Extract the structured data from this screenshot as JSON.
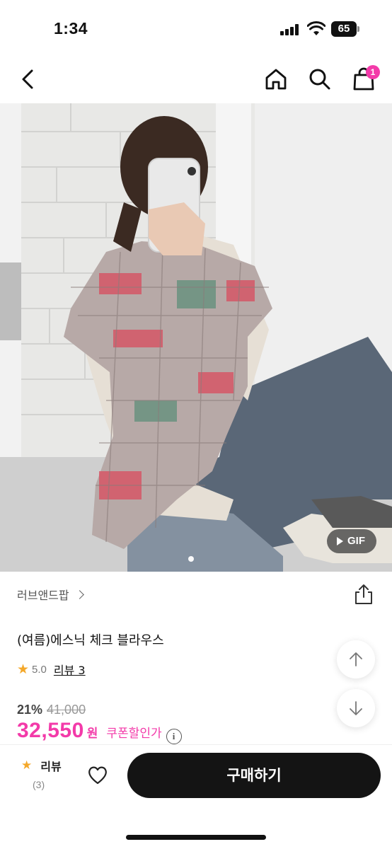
{
  "status_bar": {
    "time": "1:34",
    "battery": "65"
  },
  "nav": {
    "back_icon": "chevron-left-icon",
    "home_icon": "home-icon",
    "search_icon": "search-icon",
    "cart_icon": "shopping-bag-icon",
    "cart_count": "1"
  },
  "gallery": {
    "gif_label": "GIF",
    "page_indicator": "dot"
  },
  "product": {
    "brand": "러브앤드팝",
    "title": "(여름)에스닉 체크 블라우스",
    "rating": "5.0",
    "review_link": "리뷰 3",
    "discount": "21%",
    "original_price": "41,000",
    "price": "32,550",
    "currency": "원",
    "coupon_label": "쿠폰할인가",
    "info_symbol": "i"
  },
  "bottom_bar": {
    "review_label": "리뷰",
    "review_count": "(3)",
    "buy_label": "구매하기"
  },
  "colors": {
    "accent": "#f33aa9",
    "star": "#f4a82a",
    "buy_button": "#141414"
  }
}
